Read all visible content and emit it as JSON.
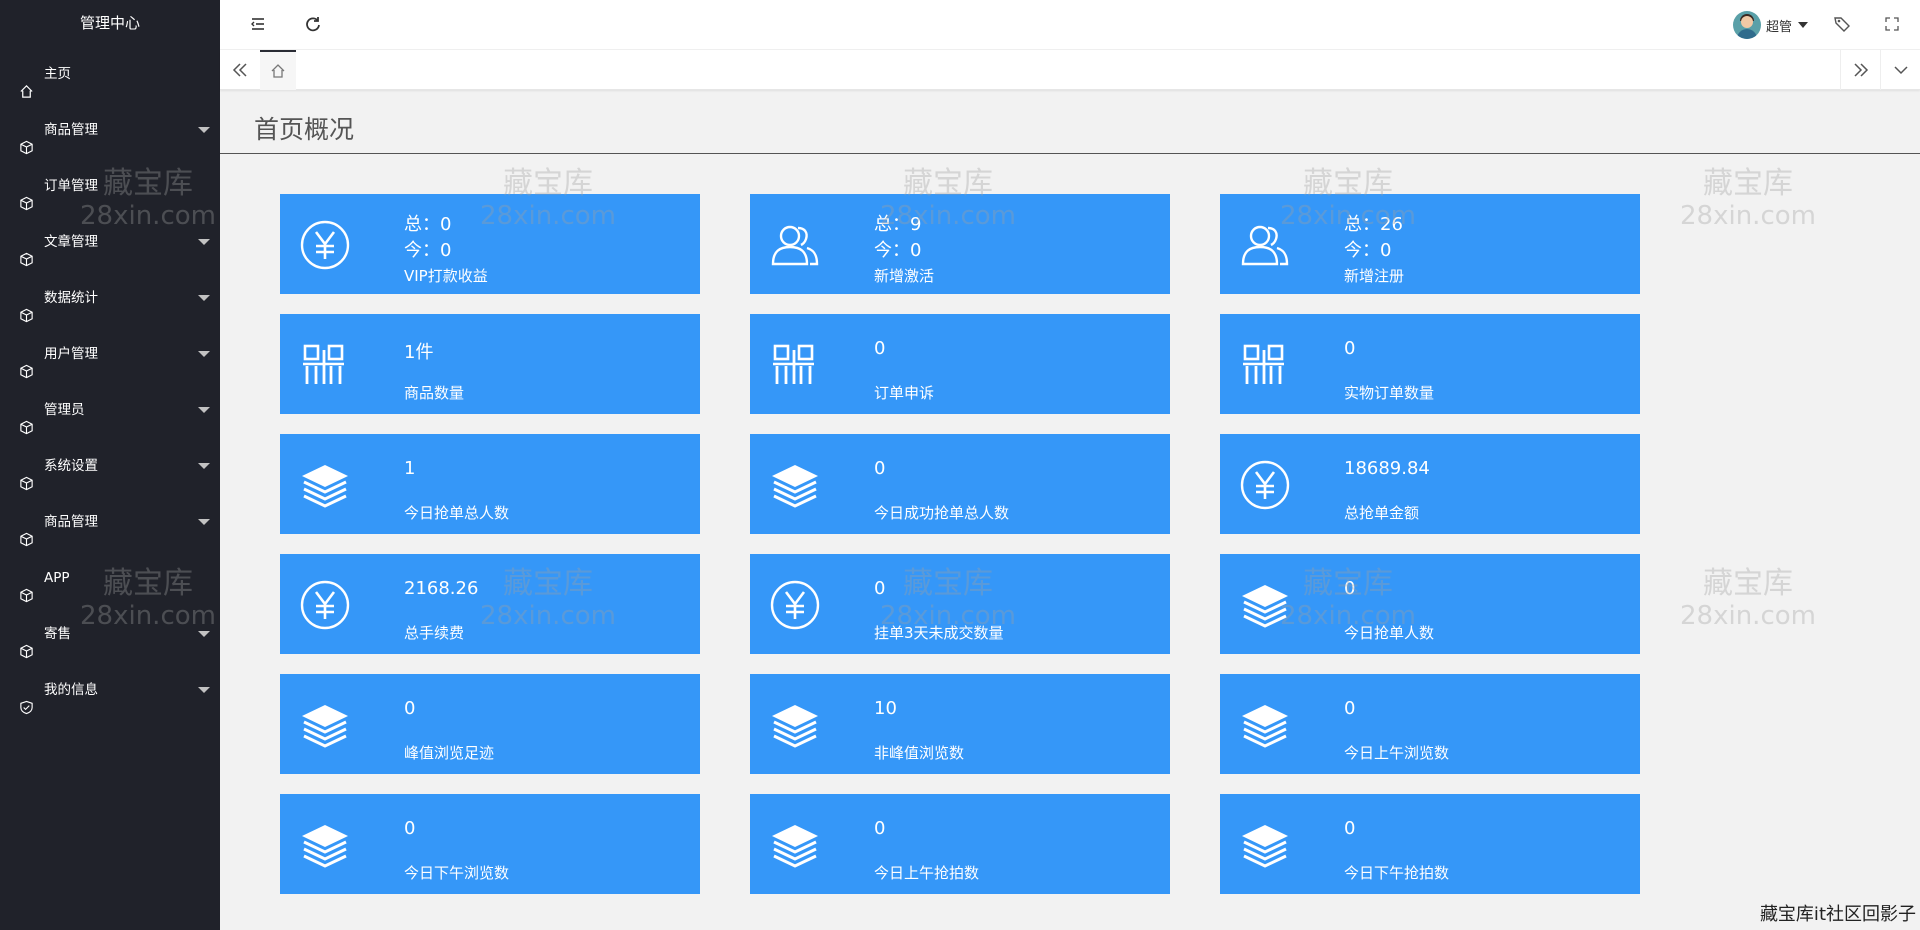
{
  "sidebar": {
    "brand": "管理中心",
    "items": [
      {
        "label": "主页",
        "icon": "home-icon",
        "has_caret": false
      },
      {
        "label": "商品管理",
        "icon": "cube-icon",
        "has_caret": true
      },
      {
        "label": "订单管理",
        "icon": "cube-icon",
        "has_caret": false
      },
      {
        "label": "文章管理",
        "icon": "cube-icon",
        "has_caret": true
      },
      {
        "label": "数据统计",
        "icon": "cube-icon",
        "has_caret": true
      },
      {
        "label": "用户管理",
        "icon": "cube-icon",
        "has_caret": true
      },
      {
        "label": "管理员",
        "icon": "cube-icon",
        "has_caret": true
      },
      {
        "label": "系统设置",
        "icon": "cube-icon",
        "has_caret": true
      },
      {
        "label": "商品管理",
        "icon": "cube-icon",
        "has_caret": true
      },
      {
        "label": "APP",
        "icon": "cube-icon",
        "has_caret": false
      },
      {
        "label": "寄售",
        "icon": "cube-icon",
        "has_caret": true
      },
      {
        "label": "我的信息",
        "icon": "shield-icon",
        "has_caret": true
      }
    ]
  },
  "header": {
    "user_name": "超管"
  },
  "page": {
    "title": "首页概况"
  },
  "cards": [
    {
      "icon": "yen-icon",
      "kind": "double",
      "line1": "总：0",
      "line2": "今：0",
      "label": "VIP打款收益"
    },
    {
      "icon": "users-icon",
      "kind": "double",
      "line1": "总：9",
      "line2": "今：0",
      "label": "新增激活"
    },
    {
      "icon": "users-icon",
      "kind": "double",
      "line1": "总：26",
      "line2": "今：0",
      "label": "新增注册"
    },
    {
      "icon": "grid-icon",
      "kind": "single",
      "value": "1件",
      "label": "商品数量"
    },
    {
      "icon": "grid-icon",
      "kind": "single",
      "value": "0",
      "label": "订单申诉"
    },
    {
      "icon": "grid-icon",
      "kind": "single",
      "value": "0",
      "label": "实物订单数量"
    },
    {
      "icon": "layers-icon",
      "kind": "single",
      "value": "1",
      "label": "今日抢单总人数"
    },
    {
      "icon": "layers-icon",
      "kind": "single",
      "value": "0",
      "label": "今日成功抢单总人数"
    },
    {
      "icon": "yen-icon",
      "kind": "single",
      "value": "18689.84",
      "label": "总抢单金额"
    },
    {
      "icon": "yen-icon",
      "kind": "single",
      "value": "2168.26",
      "label": "总手续费"
    },
    {
      "icon": "yen-icon",
      "kind": "single",
      "value": "0",
      "label": "挂单3天未成交数量"
    },
    {
      "icon": "layers-icon",
      "kind": "single",
      "value": "0",
      "label": "今日抢单人数"
    },
    {
      "icon": "layers-icon",
      "kind": "single",
      "value": "0",
      "label": "峰值浏览足迹"
    },
    {
      "icon": "layers-icon",
      "kind": "single",
      "value": "10",
      "label": "非峰值浏览数"
    },
    {
      "icon": "layers-icon",
      "kind": "single",
      "value": "0",
      "label": "今日上午浏览数"
    },
    {
      "icon": "layers-icon",
      "kind": "single",
      "value": "0",
      "label": "今日下午浏览数"
    },
    {
      "icon": "layers-icon",
      "kind": "single",
      "value": "0",
      "label": "今日上午抢拍数"
    },
    {
      "icon": "layers-icon",
      "kind": "single",
      "value": "0",
      "label": "今日下午抢拍数"
    }
  ],
  "watermark": {
    "line1": "藏宝库",
    "line2": "28xin.com"
  },
  "footer_mark": "藏宝库it社区回影子",
  "colors": {
    "sidebar_bg": "#20222a",
    "card_bg": "#3597f8",
    "page_bg": "#f2f2f2"
  }
}
